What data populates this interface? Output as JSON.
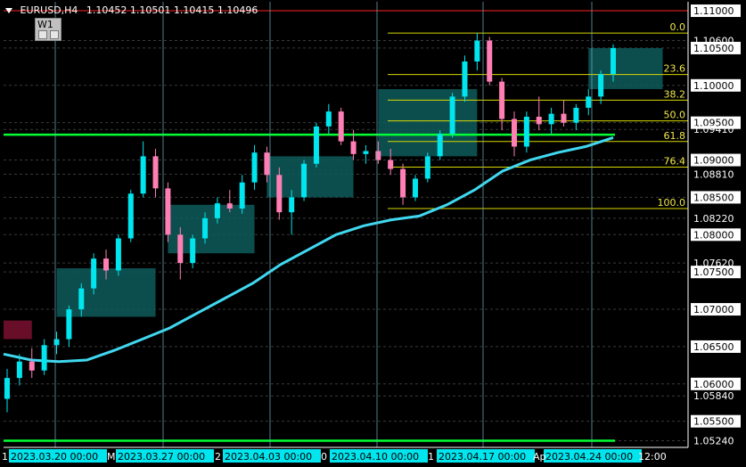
{
  "header": {
    "symbol_timeframe": "EURUSD,H4",
    "quote": "1.10452 1.10501 1.10415 1.10496"
  },
  "toolbar": {
    "timeframe_button": "W1"
  },
  "colors": {
    "background": "#000000",
    "grid": "#3a3a3a",
    "bull_candle": "#00e5ee",
    "bear_candle": "#ff7fb4",
    "moving_average": "#40d8f0",
    "fib_line": "#d8d800",
    "fib_label": "#f2e84a",
    "support_line": "#00ff33",
    "box_fill": "#0e5a5a",
    "box_red": "#7a1030",
    "current_price_line": "#ff2222"
  },
  "chart_data": {
    "type": "candlestick",
    "symbol": "EURUSD",
    "timeframe": "H4",
    "ohlc_current": {
      "open": 1.10452,
      "high": 1.10501,
      "low": 1.10415,
      "close": 1.10496
    },
    "y_axis_labels": [
      "1.11000",
      "1.10600",
      "1.10500",
      "1.10000",
      "1.09500",
      "1.09410",
      "1.09000",
      "1.08810",
      "1.08500",
      "1.08220",
      "1.08000",
      "1.07620",
      "1.07500",
      "1.07000",
      "1.06500",
      "1.06000",
      "1.05840",
      "1.05500",
      "1.05240"
    ],
    "x_axis_labels": [
      "2023.03.20 00:00",
      "2023.03.27 00:00",
      "2023.04.03 00:00",
      "2023.04.10 00:00",
      "2023.04.17 00:00",
      "2023.04.24 00:00"
    ],
    "x_axis_partial_labels": [
      "1",
      "M",
      "2",
      "0",
      "1",
      "Ap",
      "12:00"
    ],
    "ylim": [
      1.0515,
      1.1112
    ],
    "fibonacci": {
      "levels": [
        "0.0",
        "23.6",
        "38.2",
        "50.0",
        "61.8",
        "76.4",
        "100.0"
      ],
      "high": 1.107,
      "low": 1.0835
    },
    "horizontal_lines": [
      1.0934,
      1.0524
    ],
    "current_price_line": 1.11,
    "moving_average": [
      1.064,
      1.0632,
      1.063,
      1.0632,
      1.0645,
      1.066,
      1.0675,
      1.0695,
      1.0715,
      1.0735,
      1.076,
      1.078,
      1.08,
      1.0812,
      1.082,
      1.0825,
      1.084,
      1.086,
      1.0885,
      1.09,
      1.091,
      1.0918,
      1.093
    ],
    "candles": [
      [
        1.058,
        1.062,
        1.0562,
        1.0608
      ],
      [
        1.0608,
        1.064,
        1.0598,
        1.063
      ],
      [
        1.063,
        1.0648,
        1.0608,
        1.0618
      ],
      [
        1.0618,
        1.066,
        1.0612,
        1.0652
      ],
      [
        1.0652,
        1.067,
        1.064,
        1.066
      ],
      [
        1.066,
        1.0705,
        1.065,
        1.07
      ],
      [
        1.07,
        1.0735,
        1.069,
        1.0728
      ],
      [
        1.0728,
        1.0775,
        1.072,
        1.0768
      ],
      [
        1.0768,
        1.078,
        1.074,
        1.0752
      ],
      [
        1.0752,
        1.08,
        1.0745,
        1.0795
      ],
      [
        1.0795,
        1.086,
        1.079,
        1.0855
      ],
      [
        1.0855,
        1.0925,
        1.085,
        1.0905
      ],
      [
        1.0905,
        1.0915,
        1.085,
        1.0862
      ],
      [
        1.0862,
        1.087,
        1.079,
        1.08
      ],
      [
        1.08,
        1.081,
        1.074,
        1.0762
      ],
      [
        1.0762,
        1.08,
        1.0755,
        1.0795
      ],
      [
        1.0795,
        1.083,
        1.0788,
        1.0822
      ],
      [
        1.0822,
        1.085,
        1.0815,
        1.0842
      ],
      [
        1.0842,
        1.086,
        1.083,
        1.0835
      ],
      [
        1.0835,
        1.088,
        1.0828,
        1.087
      ],
      [
        1.087,
        1.092,
        1.086,
        1.091
      ],
      [
        1.091,
        1.0918,
        1.087,
        1.088
      ],
      [
        1.088,
        1.089,
        1.082,
        1.083
      ],
      [
        1.083,
        1.086,
        1.08,
        1.085
      ],
      [
        1.085,
        1.09,
        1.0845,
        1.0895
      ],
      [
        1.0895,
        1.095,
        1.089,
        1.0945
      ],
      [
        1.0945,
        1.0975,
        1.0935,
        1.0965
      ],
      [
        1.0965,
        1.097,
        1.092,
        1.0925
      ],
      [
        1.0925,
        1.094,
        1.09,
        1.0908
      ],
      [
        1.0908,
        1.092,
        1.0895,
        1.0912
      ],
      [
        1.0912,
        1.0925,
        1.0895,
        1.09
      ],
      [
        1.09,
        1.0915,
        1.088,
        1.0888
      ],
      [
        1.0888,
        1.0895,
        1.084,
        1.085
      ],
      [
        1.085,
        1.088,
        1.0845,
        1.0875
      ],
      [
        1.0875,
        1.091,
        1.087,
        1.0905
      ],
      [
        1.0905,
        1.094,
        1.09,
        1.0935
      ],
      [
        1.0935,
        1.099,
        1.093,
        1.0985
      ],
      [
        1.0985,
        1.104,
        1.0978,
        1.1032
      ],
      [
        1.1032,
        1.107,
        1.102,
        1.106
      ],
      [
        1.106,
        1.1065,
        1.1,
        1.1005
      ],
      [
        1.1005,
        1.101,
        1.094,
        1.0955
      ],
      [
        1.0955,
        1.0965,
        1.0905,
        1.0918
      ],
      [
        1.0918,
        1.0965,
        1.091,
        1.0958
      ],
      [
        1.0958,
        1.0985,
        1.094,
        1.0948
      ],
      [
        1.0948,
        1.097,
        1.0935,
        1.0962
      ],
      [
        1.0962,
        1.098,
        1.0945,
        1.095
      ],
      [
        1.095,
        1.0975,
        1.094,
        1.097
      ],
      [
        1.097,
        1.0995,
        1.096,
        1.0985
      ],
      [
        1.0985,
        1.102,
        1.0975,
        1.1015
      ],
      [
        1.1015,
        1.1055,
        1.1005,
        1.105
      ]
    ]
  }
}
